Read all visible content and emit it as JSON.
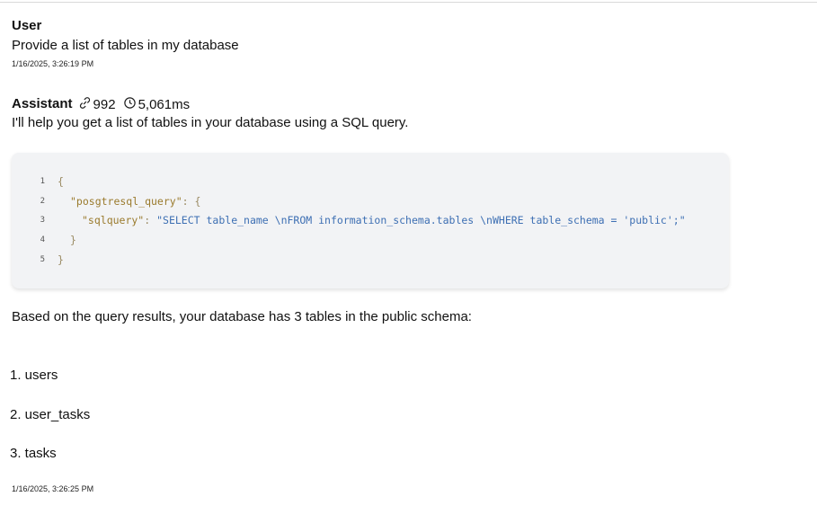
{
  "user": {
    "role": "User",
    "message": "Provide a list of tables in my database",
    "timestamp": "1/16/2025, 3:26:19 PM"
  },
  "assistant": {
    "role": "Assistant",
    "tokens": "992",
    "duration": "5,061ms",
    "intro": "I'll help you get a list of tables in your database using a SQL query.",
    "code": {
      "line_numbers": [
        "1",
        "2",
        "3",
        "4",
        "5"
      ],
      "open_brace": "{",
      "key_query": "\"posgtresql_query\"",
      "colon_brace": ": {",
      "key_sql": "\"sqlquery\"",
      "colon": ": ",
      "sql_value": "\"SELECT table_name \\nFROM information_schema.tables \\nWHERE table_schema = 'public';\"",
      "inner_close": "}",
      "outer_close": "}"
    },
    "result_intro": "Based on the query results, your database has 3 tables in the public schema:",
    "tables": [
      "1. users",
      "2. user_tasks",
      "3. tasks"
    ],
    "timestamp": "1/16/2025, 3:26:25 PM"
  },
  "icons": {
    "tokens": "link-icon",
    "duration": "clock-icon"
  }
}
